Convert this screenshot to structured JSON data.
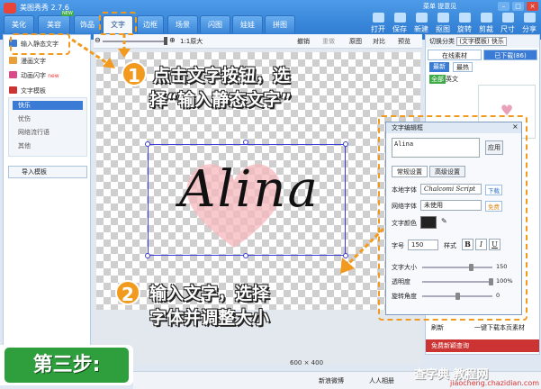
{
  "app": {
    "title": "美图秀秀 2.7.6",
    "menu_links": "菜单  提意见"
  },
  "tabs": [
    "美化",
    "美容",
    "饰品",
    "文字",
    "边框",
    "场景",
    "闪图",
    "娃娃",
    "拼图"
  ],
  "tab_badge": "NEW",
  "toolbar": [
    "打开",
    "保存",
    "新建",
    "抠图",
    "旋转",
    "剪裁",
    "尺寸",
    "分享"
  ],
  "left_panel": {
    "input_static_text": "输入静态文字",
    "comic_text": "漫画文字",
    "animated_text": "动画闪字",
    "animated_badge": "new",
    "text_template": "文字模板",
    "template_sub": [
      "快乐",
      "忧伤",
      "网络流行语",
      "其他"
    ],
    "import_template": "导入模板"
  },
  "canvas_toolbar": {
    "ratio": "1:1原大",
    "undo": "撤销",
    "redo": "重做",
    "original": "原图",
    "compare": "对比",
    "preview": "预览"
  },
  "canvas": {
    "text": "Alina",
    "size_label": "600 × 400"
  },
  "right_panel": {
    "category_label": "切换分类",
    "category_value": "(文字模板) 快乐",
    "tab_online": "在线素材",
    "tab_downloaded": "已下载(86)",
    "sub_tabs": [
      "最新",
      "最热"
    ],
    "filters": [
      "全部",
      "英文"
    ],
    "new_function": "免费新颖查询",
    "get_more": "一键下载本页素材",
    "refresh": "刷新",
    "hot": "采购"
  },
  "editor": {
    "title": "文字编辑框",
    "close": "×",
    "input_value": "Alina",
    "apply": "应用",
    "tabs": [
      "常规设置",
      "高级设置"
    ],
    "local_font_label": "本地字体",
    "local_font_value": "Chalcomi Script",
    "download": "下载",
    "web_font_label": "网络字体",
    "web_font_value": "未使用",
    "free": "免费",
    "color_label": "文字颜色",
    "size_label": "字号",
    "size_value": "150",
    "style_label": "样式",
    "styles": [
      "B",
      "I",
      "U"
    ],
    "sliders": [
      {
        "label": "文字大小",
        "value": "150",
        "level": 0.7
      },
      {
        "label": "透明度",
        "value": "100%",
        "level": 1.0
      },
      {
        "label": "旋转角度",
        "value": "0",
        "level": 0.5
      }
    ]
  },
  "annotations": {
    "step1_num": "1",
    "step1_line1": "点击文字按钮，选",
    "step1_line2": "择“输入静态文字”",
    "step2_num": "2",
    "step2_line1": "输入文字，选择",
    "step2_line2": "字体并调整大小",
    "step_badge": "第三步:"
  },
  "bottom": {
    "weibo": "新浪微博",
    "renren": "人人相册"
  },
  "watermark": {
    "main": "查字典 教程网",
    "url": "jiaocheng.chazidian.com"
  },
  "colors": {
    "accent": "#f29a1e",
    "titlebar": "#2b78cf",
    "step_green": "#2f9e3d"
  }
}
